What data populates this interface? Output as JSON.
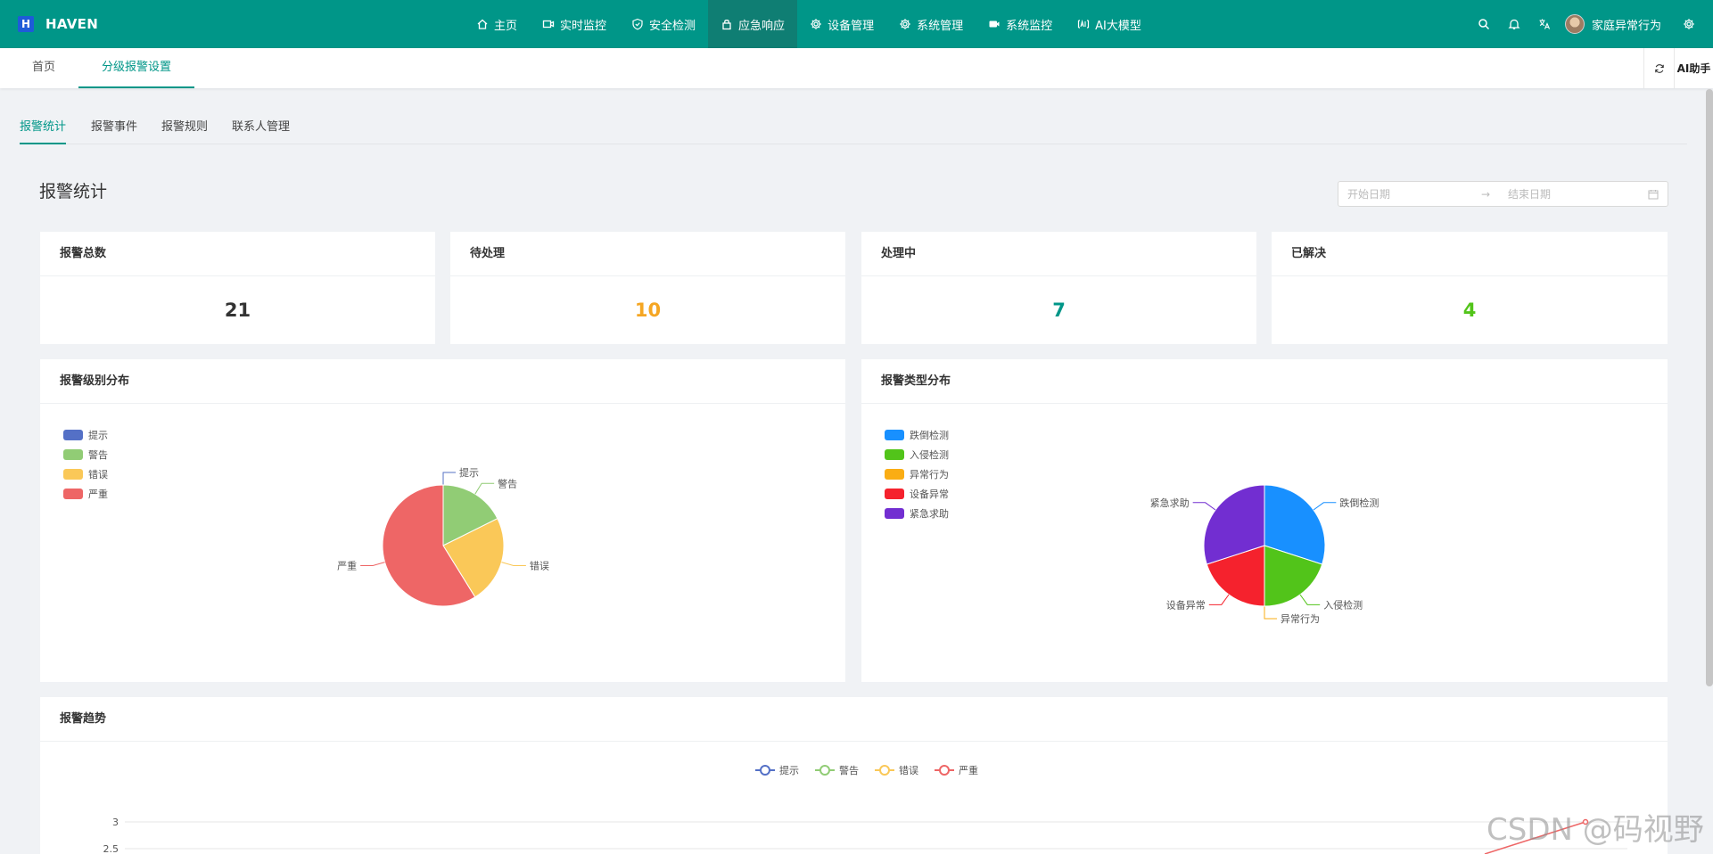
{
  "app": {
    "logo_letter": "H",
    "name": "HAVEN"
  },
  "nav": {
    "items": [
      {
        "label": "主页",
        "icon": "home-icon"
      },
      {
        "label": "实时监控",
        "icon": "video-icon"
      },
      {
        "label": "安全检测",
        "icon": "shield-icon"
      },
      {
        "label": "应急响应",
        "icon": "lock-icon",
        "active": true
      },
      {
        "label": "设备管理",
        "icon": "gear-icon"
      },
      {
        "label": "系统管理",
        "icon": "gear-icon"
      },
      {
        "label": "系统监控",
        "icon": "camera-icon"
      },
      {
        "label": "AI大模型",
        "icon": "ai-icon"
      }
    ],
    "user_name": "家庭异常行为"
  },
  "page_tabs": [
    {
      "label": "首页"
    },
    {
      "label": "分级报警设置",
      "active": true
    }
  ],
  "ai_helper": "AI助手",
  "sub_tabs": [
    {
      "label": "报警统计",
      "active": true
    },
    {
      "label": "报警事件"
    },
    {
      "label": "报警规则"
    },
    {
      "label": "联系人管理"
    }
  ],
  "section_title": "报警统计",
  "date_range": {
    "start_placeholder": "开始日期",
    "separator": "→",
    "end_placeholder": "结束日期"
  },
  "stats": [
    {
      "title": "报警总数",
      "value": "21",
      "color": "#333333"
    },
    {
      "title": "待处理",
      "value": "10",
      "color": "#f5a623"
    },
    {
      "title": "处理中",
      "value": "7",
      "color": "#009688"
    },
    {
      "title": "已解决",
      "value": "4",
      "color": "#52c41a"
    }
  ],
  "level_chart": {
    "title": "报警级别分布",
    "legend": [
      {
        "label": "提示",
        "color": "#5470c6"
      },
      {
        "label": "警告",
        "color": "#91cc75"
      },
      {
        "label": "错误",
        "color": "#fac858"
      },
      {
        "label": "严重",
        "color": "#ee6666"
      }
    ]
  },
  "type_chart": {
    "title": "报警类型分布",
    "legend": [
      {
        "label": "跌倒检测",
        "color": "#1890ff"
      },
      {
        "label": "入侵检测",
        "color": "#52c41a"
      },
      {
        "label": "异常行为",
        "color": "#faad14"
      },
      {
        "label": "设备异常",
        "color": "#f5222d"
      },
      {
        "label": "紧急求助",
        "color": "#722ed1"
      }
    ]
  },
  "trend_chart": {
    "title": "报警趋势",
    "legend": [
      {
        "label": "提示",
        "color": "#5470c6"
      },
      {
        "label": "警告",
        "color": "#91cc75"
      },
      {
        "label": "错误",
        "color": "#fac858"
      },
      {
        "label": "严重",
        "color": "#ee6666"
      }
    ],
    "y_ticks": [
      "3",
      "2.5"
    ]
  },
  "chart_data": [
    {
      "type": "pie",
      "title": "报警级别分布",
      "categories": [
        "提示",
        "警告",
        "错误",
        "严重"
      ],
      "values": [
        0,
        3,
        4,
        10
      ]
    },
    {
      "type": "pie",
      "title": "报警类型分布",
      "categories": [
        "跌倒检测",
        "入侵检测",
        "异常行为",
        "设备异常",
        "紧急求助"
      ],
      "values": [
        6,
        4,
        0,
        4,
        6
      ]
    },
    {
      "type": "line",
      "title": "报警趋势",
      "series": [
        {
          "name": "提示"
        },
        {
          "name": "警告"
        },
        {
          "name": "错误"
        },
        {
          "name": "严重"
        }
      ],
      "y_ticks": [
        2.5,
        3
      ]
    }
  ],
  "watermark": "CSDN @码视野"
}
